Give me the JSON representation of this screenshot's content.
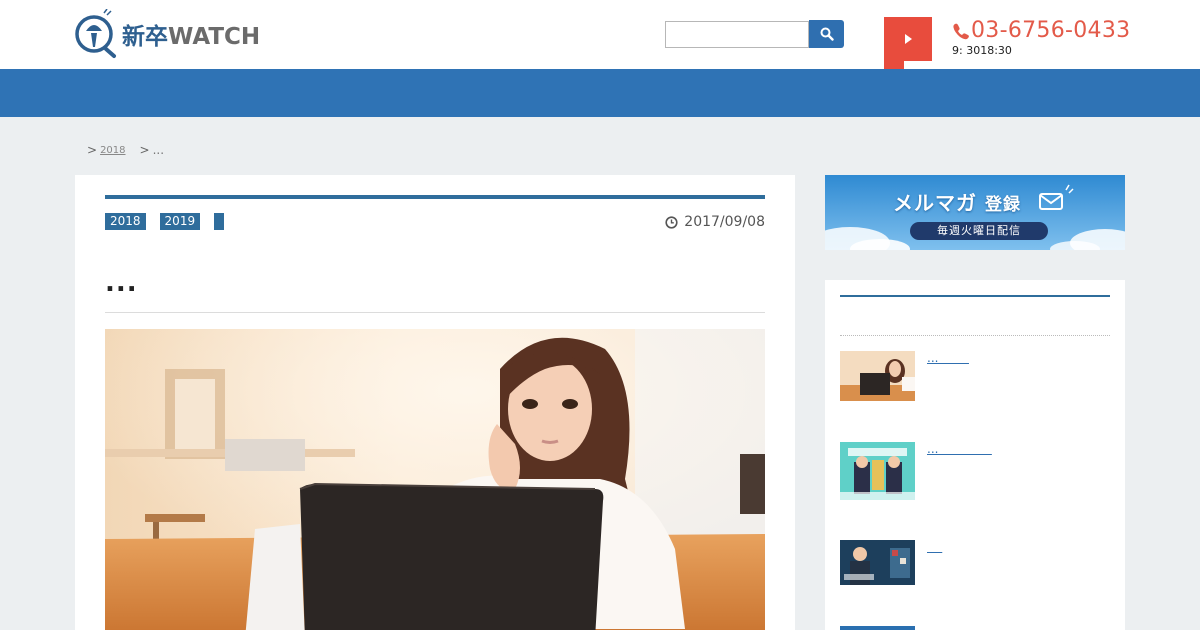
{
  "header": {
    "logo_jp": "新卒",
    "logo_en": "WATCH",
    "phone_number": "03-6756-0433",
    "phone_hours": "9: 3018:30"
  },
  "breadcrumb": {
    "sep1": ">",
    "year_link": "2018",
    "sep2": ">",
    "current": "..."
  },
  "article": {
    "tags": [
      "2018",
      "2019",
      ""
    ],
    "date": "2017/09/08",
    "title": "..."
  },
  "sidebar": {
    "banner_title_main": "メルマガ",
    "banner_title_small": "登録",
    "banner_subtitle": "毎週火曜日配信",
    "items": [
      {
        "label": "...        "
      },
      {
        "label": "...              "
      },
      {
        "label": "    "
      }
    ]
  },
  "colors": {
    "nav_blue": "#2f73b5",
    "accent_blue": "#2f6d9c",
    "phone_red": "#e35a49",
    "tab_red": "#e84c3d"
  }
}
